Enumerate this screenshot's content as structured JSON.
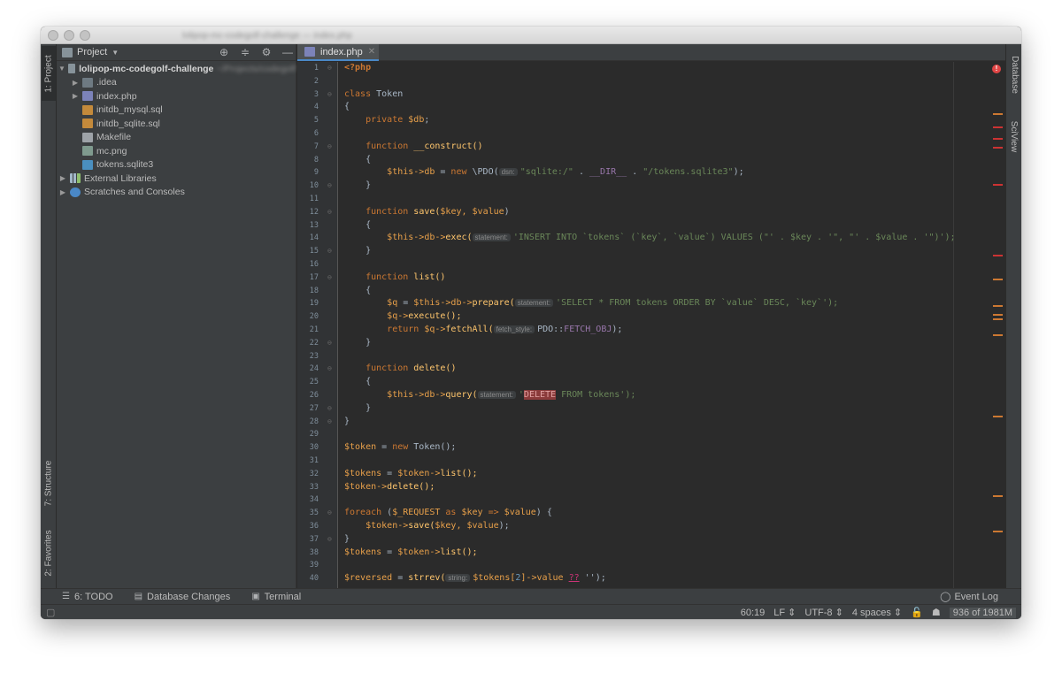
{
  "window": {
    "title_blurred": "lolipop-mc-codegolf-challenge — index.php"
  },
  "left_strip": {
    "project_tab": "1: Project",
    "structure_tab": "7: Structure",
    "favorites_tab": "2: Favorites"
  },
  "right_strip": {
    "database_tab": "Database",
    "sciview_tab": "SciView"
  },
  "project_panel": {
    "title": "Project",
    "root": "lolipop-mc-codegolf-challenge",
    "root_path": "~/Projects/codegolf",
    "items": [
      {
        "label": ".idea"
      },
      {
        "label": "index.php"
      },
      {
        "label": "initdb_mysql.sql"
      },
      {
        "label": "initdb_sqlite.sql"
      },
      {
        "label": "Makefile"
      },
      {
        "label": "mc.png"
      },
      {
        "label": "tokens.sqlite3"
      }
    ],
    "external_libraries": "External Libraries",
    "scratches": "Scratches and Consoles"
  },
  "editor": {
    "tab_label": "index.php",
    "tab_close": "✕"
  },
  "code_lines": [
    "1",
    "2",
    "3",
    "4",
    "5",
    "6",
    "7",
    "8",
    "9",
    "10",
    "11",
    "12",
    "13",
    "14",
    "15",
    "16",
    "17",
    "18",
    "19",
    "20",
    "21",
    "22",
    "23",
    "24",
    "25",
    "26",
    "27",
    "28",
    "29",
    "30",
    "31",
    "32",
    "33",
    "34",
    "35",
    "36",
    "37",
    "38",
    "39",
    "40"
  ],
  "code": {
    "l1": "<?php",
    "l3_kw": "class",
    "l3_name": "Token",
    "l4": "{",
    "l5_kw": "private",
    "l5_var": "$db",
    "l5_end": ";",
    "l7_kw": "function",
    "l7_name": "__construct()",
    "l8": "{",
    "l9_this": "$this->db",
    "l9_eq": " = ",
    "l9_new": "new",
    "l9_cls": " \\PDO(",
    "l9_hint": "dsn:",
    "l9_str1": "\"sqlite:/\"",
    "l9_dot1": " . ",
    "l9_dir": "__DIR__",
    "l9_dot2": " . ",
    "l9_str2": "\"/tokens.sqlite3\"",
    "l9_end": ");",
    "l10": "}",
    "l12_kw": "function",
    "l12_name": "save(",
    "l12_args": "$key, $value",
    "l12_end": ")",
    "l13": "{",
    "l14_this": "$this->db->",
    "l14_fn": "exec(",
    "l14_hint": "statement:",
    "l14_sql": "'INSERT INTO `tokens` (`key`, `value`) VALUES (\"' . $key . '\", \"' . $value . '\")');",
    "l15": "}",
    "l17_kw": "function",
    "l17_name": "list()",
    "l18": "{",
    "l19_var": "$q",
    "l19_eq": " = ",
    "l19_this": "$this->db->",
    "l19_fn": "prepare(",
    "l19_hint": "statement:",
    "l19_sql": "'SELECT * FROM tokens ORDER BY `value` DESC, `key`');",
    "l20_var": "$q->",
    "l20_fn": "execute();",
    "l21_kw": "return",
    "l21_var": " $q->",
    "l21_fn": "fetchAll(",
    "l21_hint": "fetch_style:",
    "l21_cls": "PDO::",
    "l21_const": "FETCH_OBJ",
    "l21_end": ");",
    "l22": "}",
    "l24_kw": "function",
    "l24_name": "delete()",
    "l25": "{",
    "l26_this": "$this->db->",
    "l26_fn": "query(",
    "l26_hint": "statement:",
    "l26_q": "'",
    "l26_err": "DELETE",
    "l26_sql": " FROM tokens",
    "l26_end": "');",
    "l27": "}",
    "l28": "}",
    "l30_var": "$token",
    "l30_eq": " = ",
    "l30_new": "new",
    "l30_rest": " Token();",
    "l32_var": "$tokens",
    "l32_eq": " = ",
    "l32_var2": "$token->",
    "l32_fn": "list();",
    "l33_var": "$token->",
    "l33_fn": "delete();",
    "l35_kw": "foreach",
    "l35_a": " (",
    "l35_var": "$_REQUEST",
    "l35_as": " as ",
    "l35_key": "$key",
    "l35_arrow": " => ",
    "l35_val": "$value",
    "l35_end": ") {",
    "l36_var": "$token->",
    "l36_fn": "save(",
    "l36_args": "$key, $value",
    "l36_end": ");",
    "l37": "}",
    "l38_var": "$tokens",
    "l38_eq": " = ",
    "l38_var2": "$token->",
    "l38_fn": "list();",
    "l40_var": "$reversed",
    "l40_eq": " = ",
    "l40_fn": "strrev(",
    "l40_hint": "string:",
    "l40_var2": "$tokens[",
    "l40_num": "2",
    "l40_rb": "]->value ",
    "l40_q": "??",
    "l40_end": " '');"
  },
  "bottom_tabs": {
    "todo": "6: TODO",
    "db_changes": "Database Changes",
    "terminal": "Terminal",
    "event_log": "Event Log"
  },
  "status": {
    "position": "60:19",
    "line_sep": "LF",
    "encoding": "UTF-8",
    "indent": "4 spaces",
    "memory": "936 of 1981M"
  },
  "colors": {
    "accent": "#4a88c7",
    "error": "#e04545",
    "warning_marker": "#cc7832"
  }
}
